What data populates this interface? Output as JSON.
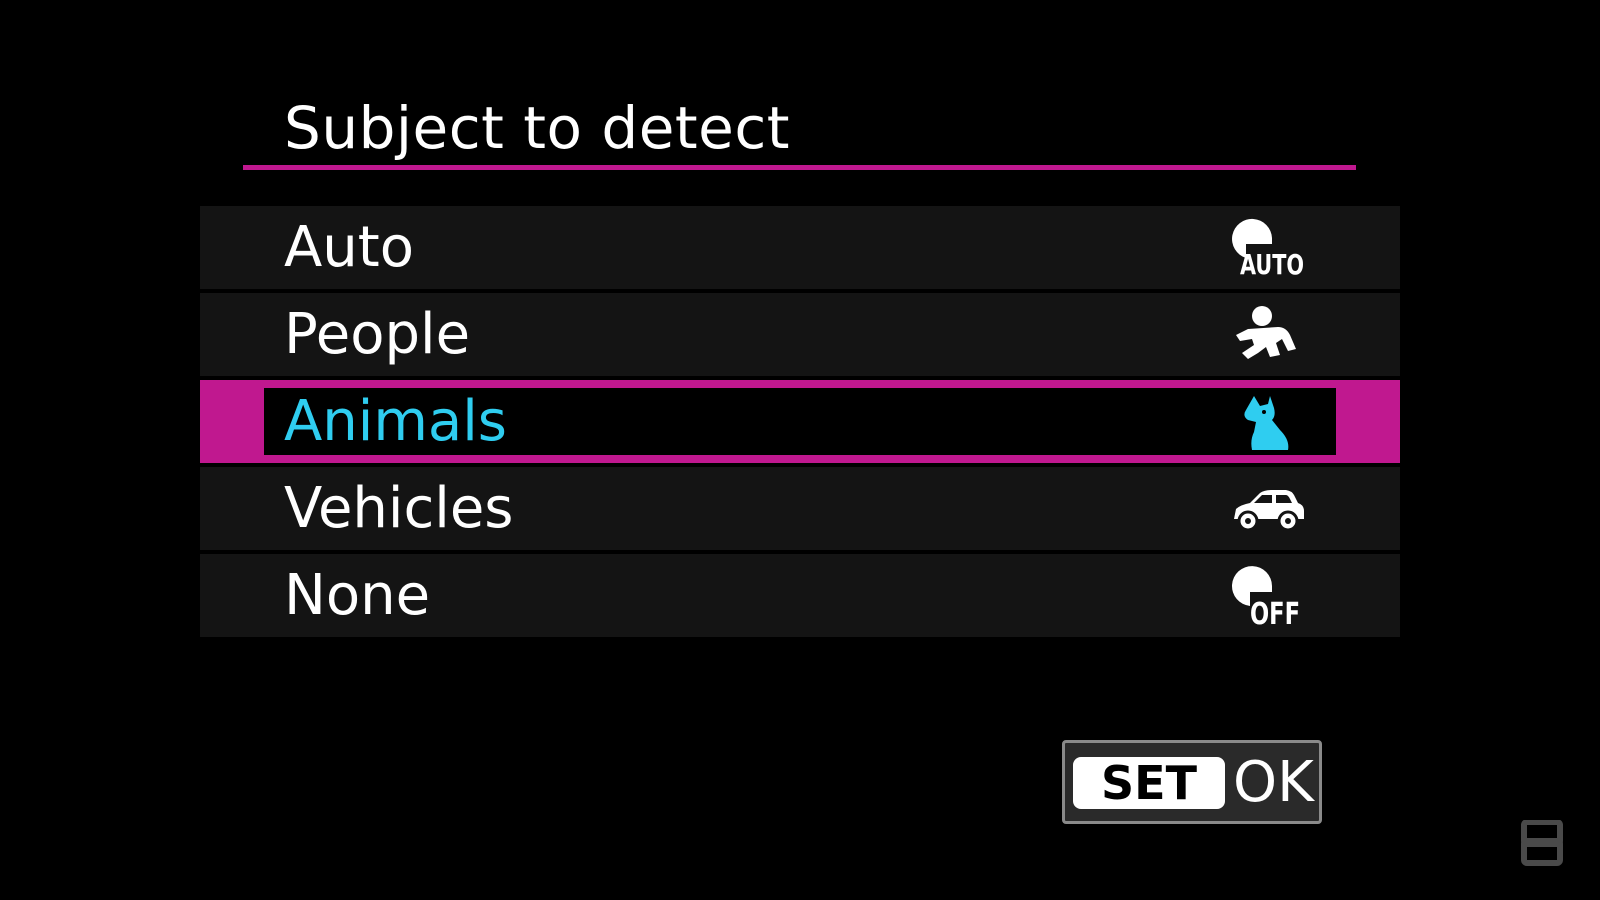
{
  "title": "Subject to detect",
  "accent_color": "#c0188f",
  "selected_text_color": "#2fcdf0",
  "menu": {
    "selected_index": 2,
    "items": [
      {
        "label": "Auto",
        "icon": "auto-detect-icon",
        "icon_text": "AUTO"
      },
      {
        "label": "People",
        "icon": "person-icon"
      },
      {
        "label": "Animals",
        "icon": "animal-icon"
      },
      {
        "label": "Vehicles",
        "icon": "vehicle-icon"
      },
      {
        "label": "None",
        "icon": "detect-off-icon",
        "icon_text": "OFF"
      }
    ]
  },
  "footer": {
    "set_key": "SET",
    "ok_label": "OK"
  }
}
